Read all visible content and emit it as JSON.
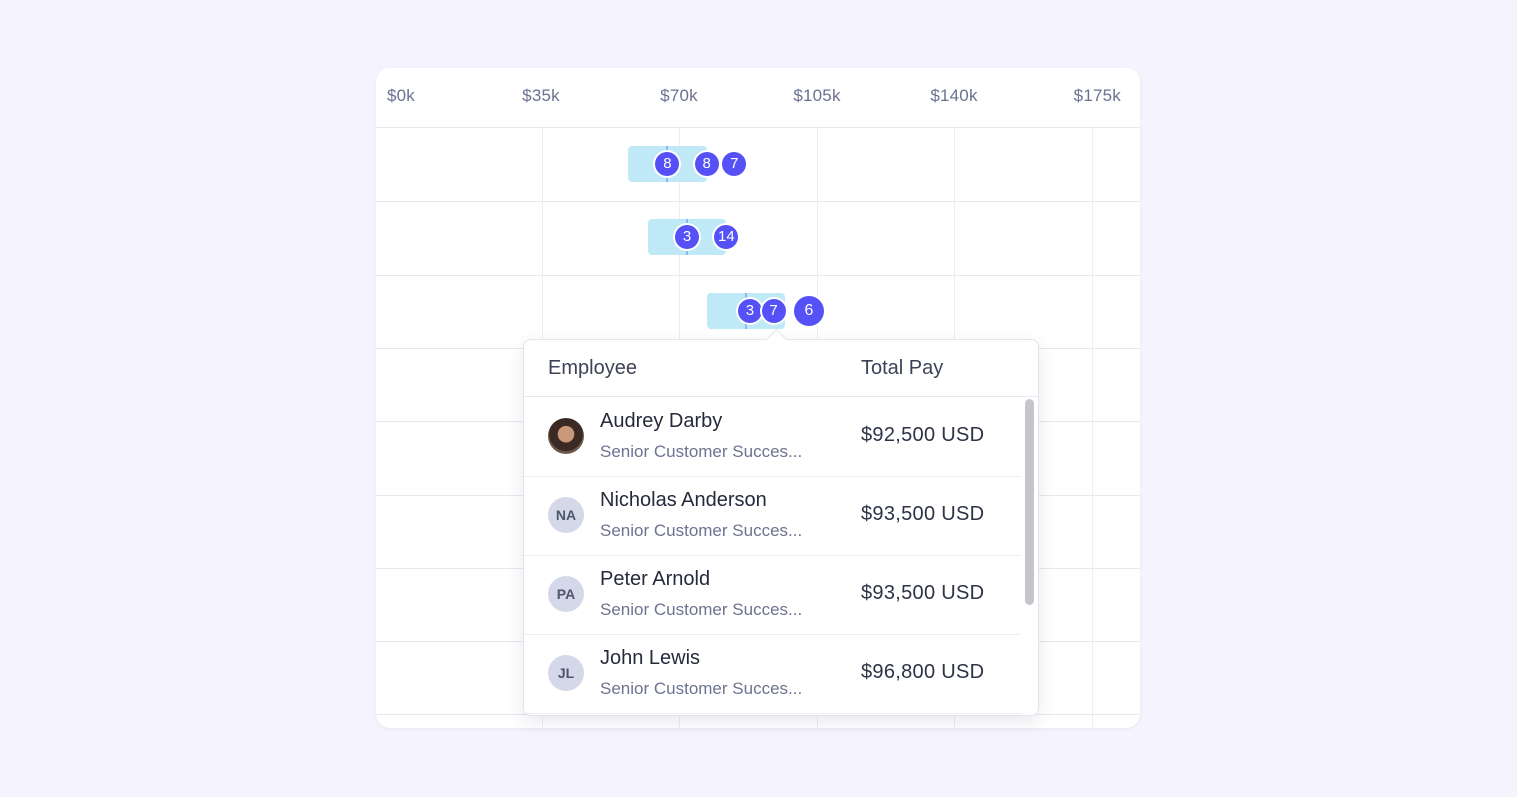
{
  "axis": {
    "ticks": [
      "$0k",
      "$35k",
      "$70k",
      "$105k",
      "$140k",
      "$175k"
    ]
  },
  "rows": [
    {
      "band_min_k": 57,
      "band_max_k": 77,
      "median_k": 67,
      "markers": [
        {
          "value_k": 67,
          "count": "8"
        },
        {
          "value_k": 77,
          "count": "8"
        },
        {
          "value_k": 84,
          "count": "7"
        }
      ]
    },
    {
      "band_min_k": 62,
      "band_max_k": 82,
      "median_k": 72,
      "markers": [
        {
          "value_k": 72,
          "count": "3"
        },
        {
          "value_k": 82,
          "count": "14"
        }
      ]
    },
    {
      "band_min_k": 77,
      "band_max_k": 97,
      "median_k": 87,
      "markers": [
        {
          "value_k": 88,
          "count": "3"
        },
        {
          "value_k": 94,
          "count": "7"
        },
        {
          "value_k": 103,
          "count": "6"
        }
      ]
    }
  ],
  "popover": {
    "col_employee": "Employee",
    "col_total_pay": "Total Pay",
    "employees": [
      {
        "name": "Audrey Darby",
        "role": "Senior Customer Succes...",
        "pay": "$92,500 USD",
        "initials": "",
        "avatar": "photo"
      },
      {
        "name": "Nicholas Anderson",
        "role": "Senior Customer Succes...",
        "pay": "$93,500 USD",
        "initials": "NA",
        "avatar": "initials"
      },
      {
        "name": "Peter Arnold",
        "role": "Senior Customer Succes...",
        "pay": "$93,500 USD",
        "initials": "PA",
        "avatar": "initials"
      },
      {
        "name": "John Lewis",
        "role": "Senior Customer Succes...",
        "pay": "$96,800 USD",
        "initials": "JL",
        "avatar": "initials"
      }
    ]
  },
  "colors": {
    "marker": "#5551f6",
    "band": "#bfe9f7",
    "median": "#8fb6ee",
    "background": "#f4f3fe"
  }
}
